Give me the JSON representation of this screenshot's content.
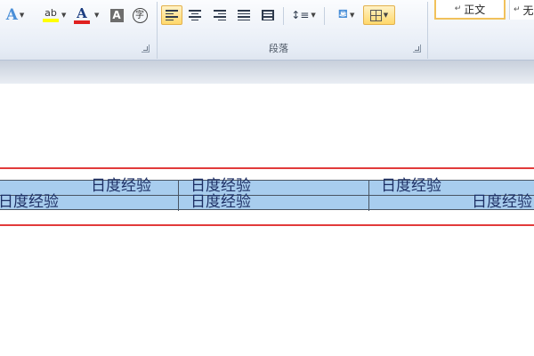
{
  "ribbon": {
    "font_group": {
      "launcher": "dialog-launcher",
      "buttons": [
        {
          "name": "text-effects",
          "glyph": "A",
          "color": "#4a8fd8"
        },
        {
          "name": "highlight",
          "glyph": "ab",
          "color": "#ffff00"
        },
        {
          "name": "font-color",
          "glyph": "A",
          "color": "#e02020"
        },
        {
          "name": "char-shading",
          "glyph": "A"
        },
        {
          "name": "enclose-char",
          "glyph": "字"
        }
      ]
    },
    "paragraph_group": {
      "label": "段落",
      "buttons": [
        "align-left",
        "align-center",
        "align-right",
        "justify",
        "distributed",
        "line-spacing",
        "shading",
        "borders"
      ]
    },
    "styles": {
      "normal_label": "正文",
      "next_label": "无"
    }
  },
  "table": {
    "rows": [
      [
        "日度经验",
        "日度经验",
        "日度经验",
        ""
      ],
      [
        "日度经验",
        "日度经验",
        "",
        "日度经验"
      ]
    ],
    "fill_color": "#a8cdee",
    "highlight_box_color": "#e23b3b"
  }
}
